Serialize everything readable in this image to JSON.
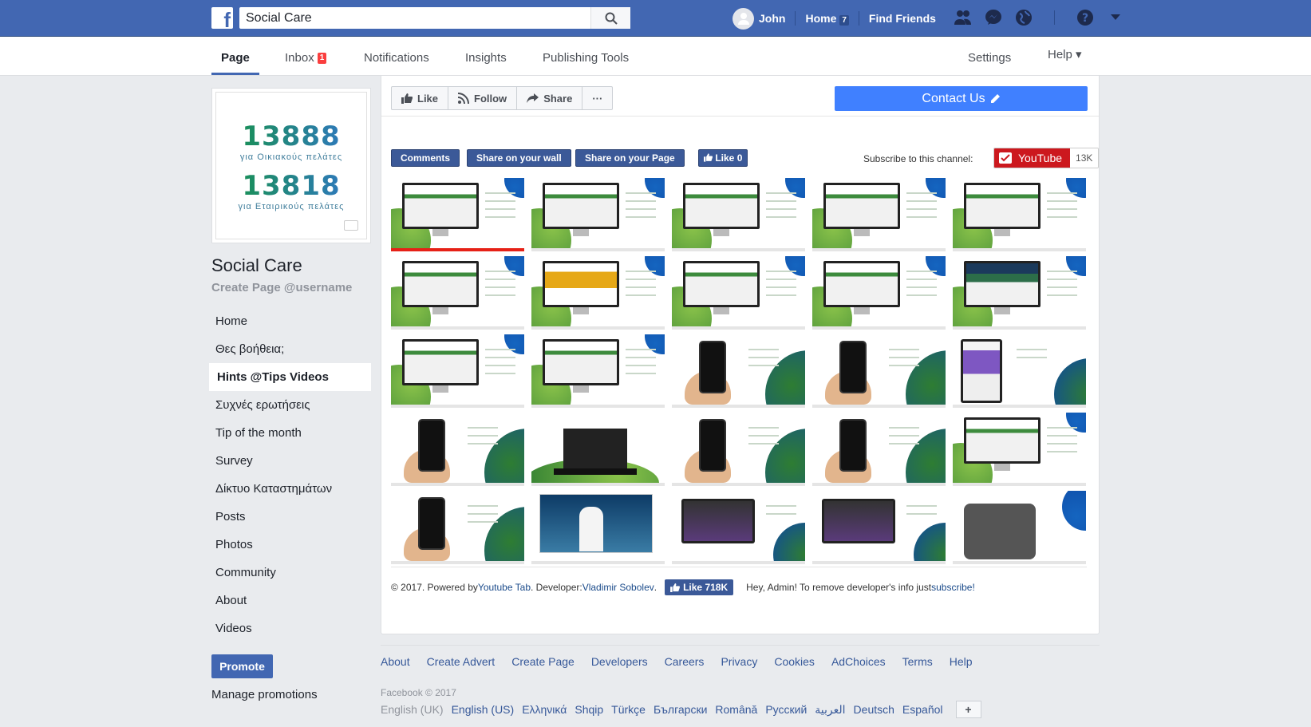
{
  "topbar": {
    "logo": "f",
    "search_value": "Social Care",
    "user_name": "John",
    "home_label": "Home",
    "home_count": "7",
    "find_friends_label": "Find Friends"
  },
  "page_tabs": {
    "page": "Page",
    "inbox": "Inbox",
    "inbox_count": "1",
    "notifications": "Notifications",
    "insights": "Insights",
    "publishing_tools": "Publishing Tools",
    "settings": "Settings",
    "help": "Help ▾"
  },
  "profile": {
    "number_1": "13888",
    "number_1_sub": "για Οικιακούς πελάτες",
    "number_2": "13818",
    "number_2_sub": "για Εταιρικούς πελάτες",
    "name": "Social Care",
    "username": "Create Page @username"
  },
  "sidebar": {
    "items": [
      {
        "label": "Home"
      },
      {
        "label": "Θες βοήθεια;"
      },
      {
        "label": "Hints @Tips Videos"
      },
      {
        "label": "Συχνές ερωτήσεις"
      },
      {
        "label": "Tip of the month"
      },
      {
        "label": "Survey"
      },
      {
        "label": "Δίκτυο Καταστημάτων"
      },
      {
        "label": "Posts"
      },
      {
        "label": "Photos"
      },
      {
        "label": "Community"
      },
      {
        "label": "About"
      },
      {
        "label": "Videos"
      }
    ],
    "active_index": 2,
    "promote_label": "Promote",
    "manage_promotions_label": "Manage promotions"
  },
  "actions": {
    "like": "Like",
    "follow": "Follow",
    "share": "Share",
    "more": "···",
    "contact_us": "Contact Us"
  },
  "youtube_tab": {
    "comments": "Comments",
    "share_wall": "Share on your wall",
    "share_page": "Share on your Page",
    "like_label": "Like",
    "like_count": "0",
    "subscribe_label": "Subscribe to this channel:",
    "youtube_label": "YouTube",
    "subscriber_count": "13K",
    "thumbnail_count": 25,
    "footer_copyright": "© 2017. Powered by ",
    "footer_powered_link": "Youtube Tab",
    "footer_dev_label": ". Developer: ",
    "footer_dev_link": "Vladimir Sobolev",
    "footer_dev_end": ".",
    "footer_like": "Like 718K",
    "footer_admin_text": "Hey, Admin! To remove developer's info just ",
    "footer_admin_link": "subscribe!"
  },
  "page_footer": {
    "links": [
      "About",
      "Create Advert",
      "Create Page",
      "Developers",
      "Careers",
      "Privacy",
      "Cookies",
      "AdChoices",
      "Terms",
      "Help"
    ],
    "copyright": "Facebook © 2017",
    "current_language": "English (UK)",
    "languages": [
      "English (US)",
      "Ελληνικά",
      "Shqip",
      "Türkçe",
      "Български",
      "Română",
      "Русский",
      "العربية",
      "Deutsch",
      "Español"
    ]
  },
  "colors": {
    "facebook_blue": "#4267b2",
    "contact_blue": "#4080ff",
    "youtube_red": "#cc181e",
    "badge_red": "#fa3e3e"
  }
}
